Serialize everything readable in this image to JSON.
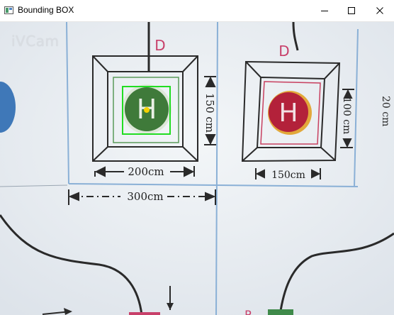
{
  "window": {
    "title": "Bounding BOX",
    "controls": {
      "minimize": "minimize",
      "maximize": "maximize",
      "close": "close"
    }
  },
  "camera": {
    "watermark": "iVCam"
  },
  "scene": {
    "pad_left": {
      "zone_letter": "D",
      "helipad_letter": "H",
      "width_label": "200cm",
      "height_label": "150 cm"
    },
    "pad_right": {
      "zone_letter": "D",
      "helipad_letter": "H",
      "width_label": "150cm",
      "height_label": "100 cm"
    },
    "total_width_label": "300cm",
    "side_label": "20 cm",
    "bottom_letter": "P"
  },
  "detection": {
    "box_color": "#22dd22",
    "center_color": "#f5d000",
    "target": "pad_left"
  },
  "colors": {
    "pad_left_fill": "#3f7a3a",
    "pad_right_fill": "#b3213a",
    "letter_red": "#c8406a",
    "line_blue": "#8ab0d6"
  }
}
